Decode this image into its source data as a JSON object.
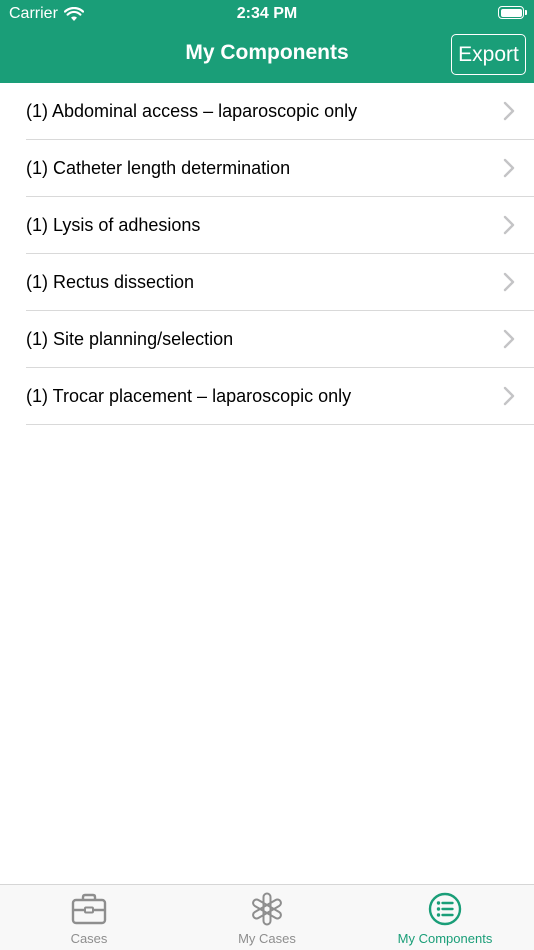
{
  "status_bar": {
    "carrier": "Carrier",
    "time": "2:34 PM"
  },
  "nav": {
    "title": "My Components",
    "export_label": "Export"
  },
  "components": [
    {
      "label": "(1) Abdominal access – laparoscopic only"
    },
    {
      "label": "(1) Catheter length determination"
    },
    {
      "label": "(1) Lysis of adhesions"
    },
    {
      "label": "(1) Rectus dissection"
    },
    {
      "label": "(1) Site planning/selection"
    },
    {
      "label": "(1) Trocar placement – laparoscopic only"
    }
  ],
  "tabs": [
    {
      "label": "Cases",
      "icon": "briefcase-icon",
      "active": false
    },
    {
      "label": "My Cases",
      "icon": "asterisk-icon",
      "active": false
    },
    {
      "label": "My Components",
      "icon": "list-icon",
      "active": true
    }
  ],
  "colors": {
    "brand": "#1a9e78",
    "inactive_tab": "#8e8e8e",
    "chevron": "#c4c4c6"
  }
}
